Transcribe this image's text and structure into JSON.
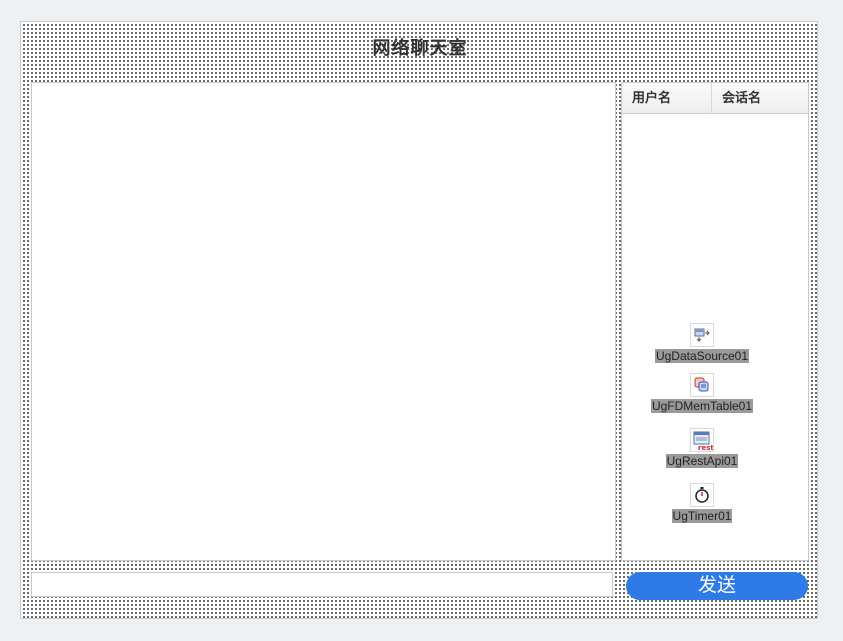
{
  "form": {
    "title": "网络聊天室"
  },
  "user_grid": {
    "columns": [
      "用户名",
      "会话名"
    ]
  },
  "components": [
    {
      "name": "UgDataSource01",
      "icon": "datasource-icon"
    },
    {
      "name": "UgFDMemTable01",
      "icon": "memtable-icon"
    },
    {
      "name": "UgRestApi01",
      "icon": "rest-api-icon"
    },
    {
      "name": "UgTimer01",
      "icon": "timer-icon"
    }
  ],
  "message_input": {
    "value": "",
    "placeholder": ""
  },
  "send_button": {
    "label": "发送"
  },
  "colors": {
    "send_button_bg": "#2e7be8",
    "page_bg": "#eef1f3"
  }
}
